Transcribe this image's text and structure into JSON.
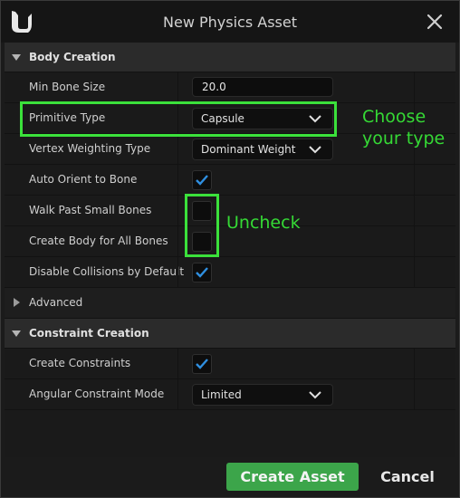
{
  "window": {
    "title": "New Physics Asset"
  },
  "sections": {
    "body_creation": "Body Creation",
    "advanced": "Advanced",
    "constraint_creation": "Constraint Creation"
  },
  "body": {
    "min_bone_size": {
      "label": "Min Bone Size",
      "value": "20.0"
    },
    "primitive_type": {
      "label": "Primitive Type",
      "value": "Capsule"
    },
    "vertex_weighting": {
      "label": "Vertex Weighting Type",
      "value": "Dominant Weight"
    },
    "auto_orient": {
      "label": "Auto Orient to Bone",
      "checked": true
    },
    "walk_past": {
      "label": "Walk Past Small Bones",
      "checked": false
    },
    "create_body_all": {
      "label": "Create Body for All Bones",
      "checked": false
    },
    "disable_collisions": {
      "label": "Disable Collisions by Default",
      "checked": true
    }
  },
  "constraints": {
    "create_constraints": {
      "label": "Create Constraints",
      "checked": true
    },
    "angular_mode": {
      "label": "Angular Constraint Mode",
      "value": "Limited"
    }
  },
  "annotations": {
    "choose_line1": "Choose",
    "choose_line2": "your type",
    "uncheck": "Uncheck",
    "color": "#35d935"
  },
  "buttons": {
    "create": "Create Asset",
    "cancel": "Cancel"
  },
  "colors": {
    "accent_check": "#2f8fe0",
    "create_button": "#3ca54a"
  }
}
